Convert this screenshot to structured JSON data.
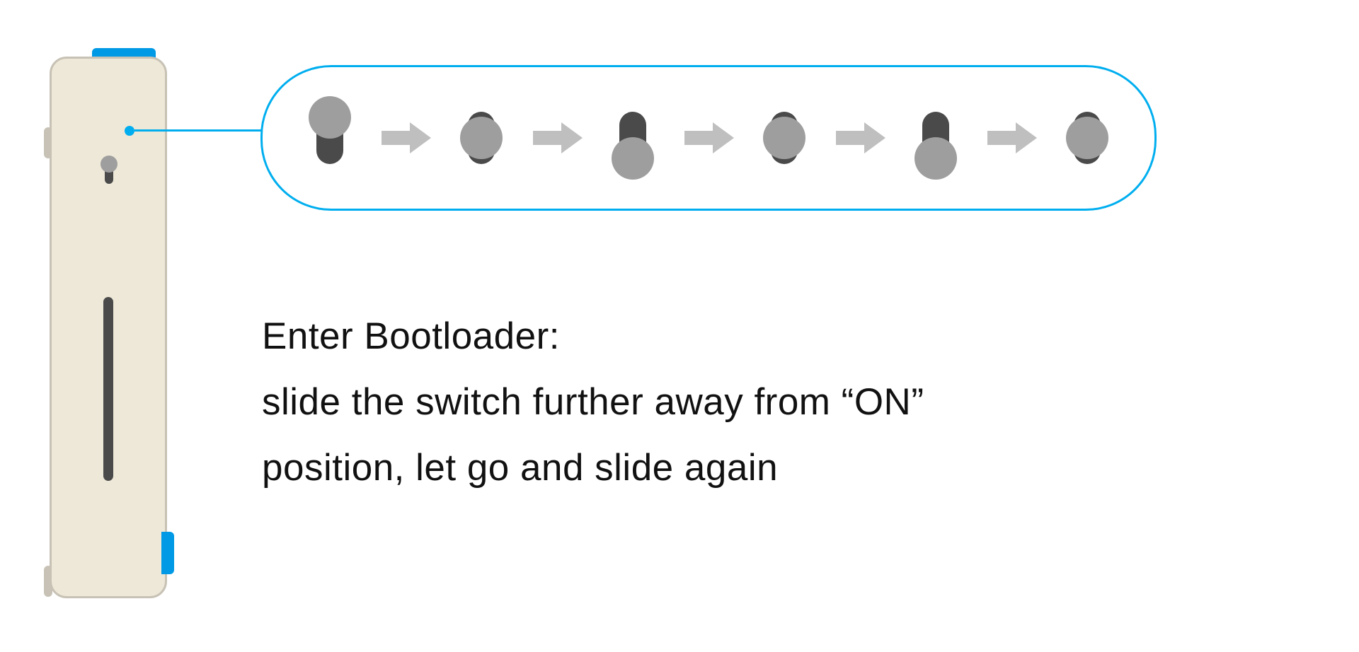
{
  "colors": {
    "callout": "#00aeef",
    "device_body": "#eee8d8",
    "device_border": "#c7c2b5",
    "accent_blue": "#0099e5",
    "knob": "#9e9e9e",
    "track": "#4a4a4a",
    "arrow": "#bfbfbf"
  },
  "instructions": {
    "line1": "Enter Bootloader:",
    "line2": "slide the switch further away from “ON”",
    "line3": "position, let go and slide again"
  },
  "switch_sequence": {
    "positions": [
      "top",
      "mid",
      "bottom",
      "mid",
      "bottom",
      "mid"
    ],
    "arrow_icon": "arrow-right-icon"
  }
}
